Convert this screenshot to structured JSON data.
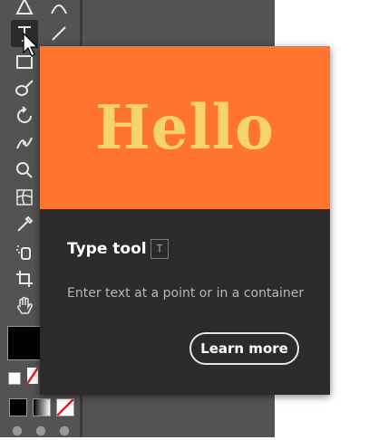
{
  "tooltip": {
    "hero_text": "Hello",
    "title": "Type tool",
    "shortcut": "T",
    "description": "Enter text at a point or in a container",
    "learn_more_label": "Learn more"
  },
  "colors": {
    "hero_background": "#ff742e",
    "hero_text": "#f7d36c",
    "card_background": "#2b2b2b",
    "toolbar_background": "#535353"
  },
  "tools": [
    "pen-tool-icon",
    "curvature-tool-icon",
    "type-tool-icon",
    "line-tool-icon",
    "rectangle-tool-icon",
    "paintbrush-tool-icon",
    "rotate-tool-icon",
    "puppet-warp-tool-icon",
    "shape-builder-tool-icon",
    "mesh-tool-icon",
    "eyedropper-tool-icon",
    "symbol-sprayer-tool-icon",
    "artboard-tool-icon",
    "hand-tool-icon"
  ]
}
